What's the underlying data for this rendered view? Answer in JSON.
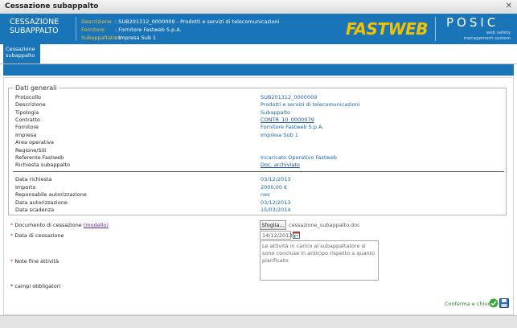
{
  "window": {
    "title": "Cessazione subappalto",
    "close_symbol": "✕"
  },
  "header": {
    "title_line1": "CESSAZIONE",
    "title_line2": "SUBAPPALTO",
    "info": [
      {
        "key": "Descrizione",
        "value": ": SUB201312_0000009 - Prodotti e servizi di telecomunicazioni"
      },
      {
        "key": "Fornitore",
        "value": ": Fornitore Fastweb S.p.A."
      },
      {
        "key": "Subappaltatore",
        "value": ": Impresa Sub 1"
      }
    ],
    "logo_fastweb": "FASTWEB",
    "logo_posic": "POSIC",
    "posic_sub1": "web safety",
    "posic_sub2": "management system"
  },
  "tab": {
    "line1": "Cessazione",
    "line2": "subappalto"
  },
  "general": {
    "legend": "Dati generali",
    "rows": [
      {
        "label": "Protocollo",
        "value": "SUB201312_0000009"
      },
      {
        "label": "Descrizione",
        "value": "Prodotti e servizi di telecomunicazioni"
      },
      {
        "label": "Tipologia",
        "value": "Subappalto"
      },
      {
        "label": "Contratto",
        "value": "CONTR_10_0000079"
      },
      {
        "label": "Fornitore",
        "value": "Fornitore Fastweb S.p.A."
      },
      {
        "label": "Impresa",
        "value": "Impresa Sub 1"
      },
      {
        "label": "Area operativa",
        "value": ""
      },
      {
        "label": "Regione/Siti",
        "value": ""
      },
      {
        "label": "Referente Fastweb",
        "value": "Incaricato Operativo Fastweb"
      },
      {
        "label": "Richiesta subappalto",
        "value": "Doc. archiviato"
      }
    ],
    "rows2": [
      {
        "label": "Data richiesta",
        "value": "03/12/2013"
      },
      {
        "label": "Importo",
        "value": "2000,00 €"
      },
      {
        "label": "Reponsabile autorizzazione",
        "value": "nes"
      },
      {
        "label": "Data autorizzazione",
        "value": "03/12/2013"
      },
      {
        "label": "Data scadenza",
        "value": "15/03/2014"
      }
    ]
  },
  "form": {
    "doc_label": "Documento di cessazione",
    "doc_model_link": "(modello)",
    "browse_button": "Sfoglia...",
    "file_name": "cessazione_subappalto.doc",
    "date_label": "Data di cessazione",
    "date_value": "14/12/2013",
    "notes_label": "Note fine attività",
    "notes_value": "Le attività in carico al subappaltatore si sono concluse in anticipo rispetto a quanto pianficato.",
    "required_mark": "*",
    "required_note": "* campi obbligatori"
  },
  "actions": {
    "confirm_label": "Conferma e chiudi"
  },
  "colors": {
    "header_blue": "#1a74b8",
    "fastweb_yellow": "#f2c200",
    "link_blue": "#1a66b0"
  }
}
